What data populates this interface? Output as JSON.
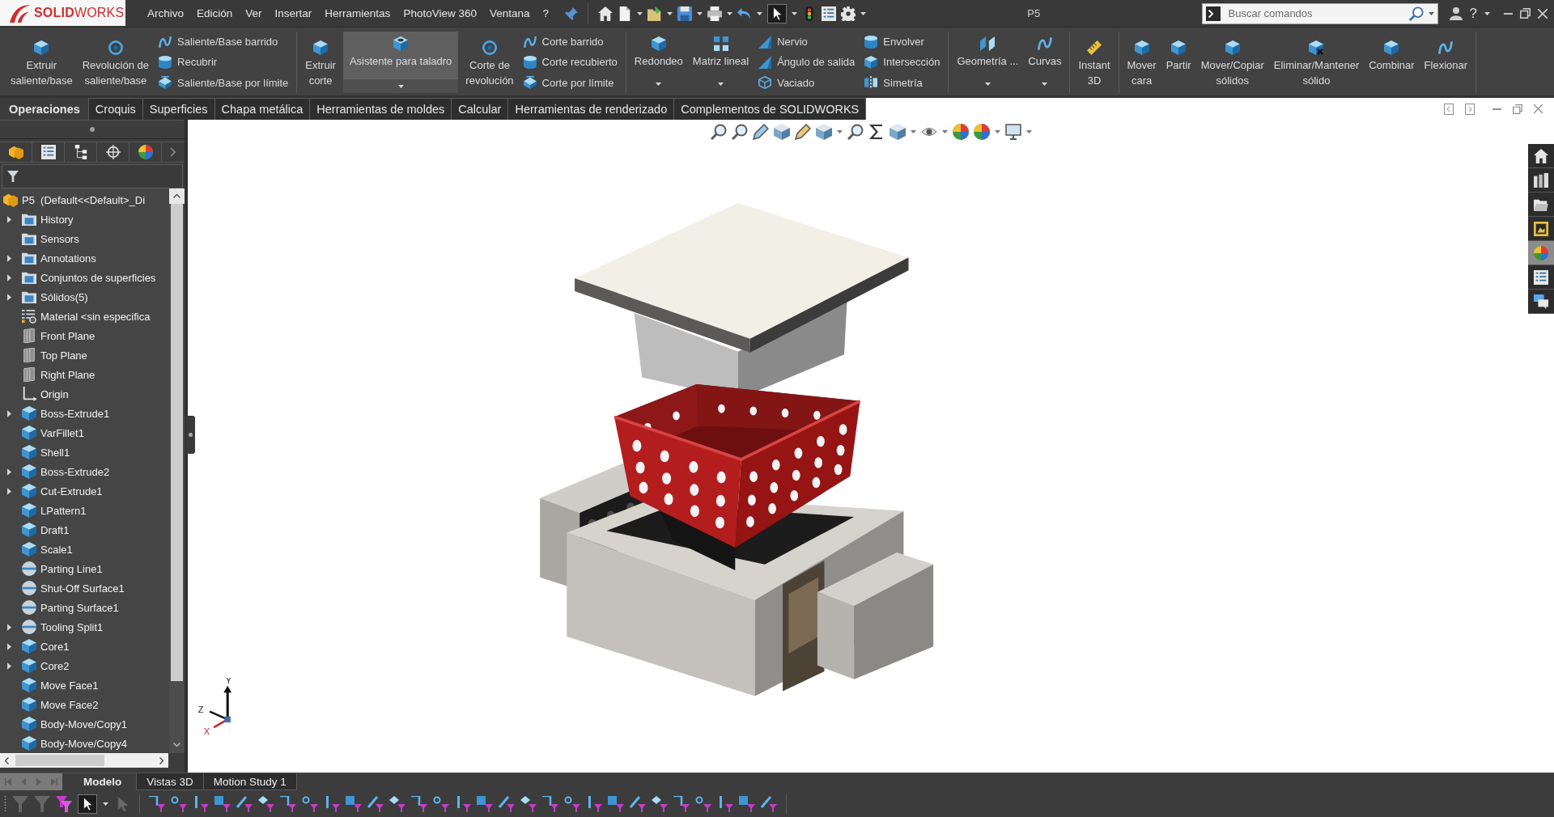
{
  "app_bar": {
    "logo": "**SOLID**WORKS",
    "menu": [
      "Archivo",
      "Edición",
      "Ver",
      "Insertar",
      "Herramientas",
      "PhotoView 360",
      "Ventana",
      "?"
    ],
    "quick_access": [
      {
        "pressed": false
      },
      {
        "pressed": false
      },
      {
        "pressed": false
      },
      {
        "pressed": false
      },
      {
        "pressed": false
      },
      {
        "pressed": false
      },
      {
        "pressed": true
      },
      {
        "pressed": false
      },
      {
        "pressed": false
      },
      {
        "pressed": false
      }
    ],
    "document_title": "P5",
    "search": {
      "placeholder": "Buscar comandos"
    },
    "help": "?"
  },
  "command_manager": {
    "groups": [
      {
        "items": [
          {
            "kind": "button",
            "label": "Extruir\nsaliente/base",
            "hovered": false
          },
          {
            "kind": "button",
            "label": "Revolución de\nsaliente/base",
            "hovered": false
          },
          {
            "kind": "stack",
            "commands": [
              "Saliente/Base barrido",
              "Recubrir",
              "Saliente/Base por límite"
            ]
          }
        ]
      },
      {
        "items": [
          {
            "kind": "button",
            "label": "Extruir\ncorte",
            "hovered": false
          },
          {
            "kind": "split",
            "label": "Asistente para taladro",
            "hovered": true
          },
          {
            "kind": "button",
            "label": "Corte de\nrevolución",
            "hovered": false
          },
          {
            "kind": "stack",
            "commands": [
              "Corte barrido",
              "Corte recubierto",
              "Corte por límite"
            ]
          }
        ]
      },
      {
        "items": [
          {
            "kind": "menu",
            "label": "Redondeo",
            "hovered": false
          },
          {
            "kind": "menu",
            "label": "Matriz lineal",
            "hovered": false
          },
          {
            "kind": "stack",
            "commands": [
              "Nervio",
              "Ángulo de salida",
              "Vaciado"
            ]
          },
          {
            "kind": "stack",
            "commands": [
              "Envolver",
              "Intersección",
              "Simetría"
            ]
          }
        ]
      },
      {
        "items": [
          {
            "kind": "menu",
            "label": "Geometría ...",
            "hovered": false
          },
          {
            "kind": "menu",
            "label": "Curvas",
            "hovered": false
          }
        ]
      },
      {
        "items": [
          {
            "kind": "button",
            "label": "Instant\n3D",
            "hovered": false
          }
        ]
      },
      {
        "items": [
          {
            "kind": "button",
            "label": "Mover\ncara",
            "hovered": false
          },
          {
            "kind": "button",
            "label": "Partir",
            "hovered": false
          },
          {
            "kind": "button",
            "label": "Mover/Copiar\nsólidos",
            "hovered": false
          },
          {
            "kind": "button",
            "label": "Eliminar/Mantener\nsólido",
            "hovered": false
          },
          {
            "kind": "button",
            "label": "Combinar",
            "hovered": false
          },
          {
            "kind": "button",
            "label": "Flexionar",
            "hovered": false
          }
        ]
      }
    ]
  },
  "tabs": [
    {
      "label": "Operaciones",
      "selected": true
    },
    {
      "label": "Croquis",
      "selected": false
    },
    {
      "label": "Superficies",
      "selected": false
    },
    {
      "label": "Chapa metálica",
      "selected": false
    },
    {
      "label": "Herramientas de moldes",
      "selected": false
    },
    {
      "label": "Calcular",
      "selected": false
    },
    {
      "label": "Herramientas de renderizado",
      "selected": false
    },
    {
      "label": "Complementos de SOLIDWORKS",
      "selected": false
    }
  ],
  "feature_tree": {
    "root": {
      "label": "P5  (Default<<Default>_Di",
      "kind": "part",
      "children": [
        {
          "label": "History",
          "kind": "folder",
          "collapsed": true
        },
        {
          "label": "Sensors",
          "kind": "folder",
          "collapsed": false
        },
        {
          "label": "Annotations",
          "kind": "folder",
          "collapsed": true
        },
        {
          "label": "Conjuntos de superficies",
          "kind": "folder",
          "collapsed": true
        },
        {
          "label": "Sólidos(5)",
          "kind": "folder",
          "collapsed": true
        },
        {
          "label": "Material <sin especifica",
          "kind": "material",
          "collapsed": false
        },
        {
          "label": "Front Plane",
          "kind": "plane",
          "collapsed": false
        },
        {
          "label": "Top Plane",
          "kind": "plane",
          "collapsed": false
        },
        {
          "label": "Right Plane",
          "kind": "plane",
          "collapsed": false
        },
        {
          "label": "Origin",
          "kind": "origin",
          "collapsed": false
        },
        {
          "label": "Boss-Extrude1",
          "kind": "feature",
          "collapsed": true
        },
        {
          "label": "VarFillet1",
          "kind": "feature",
          "collapsed": false
        },
        {
          "label": "Shell1",
          "kind": "feature",
          "collapsed": false
        },
        {
          "label": "Boss-Extrude2",
          "kind": "feature",
          "collapsed": true
        },
        {
          "label": "Cut-Extrude1",
          "kind": "feature",
          "collapsed": true
        },
        {
          "label": "LPattern1",
          "kind": "feature",
          "collapsed": false
        },
        {
          "label": "Draft1",
          "kind": "feature",
          "collapsed": false
        },
        {
          "label": "Scale1",
          "kind": "feature",
          "collapsed": false
        },
        {
          "label": "Parting Line1",
          "kind": "mold",
          "collapsed": false
        },
        {
          "label": "Shut-Off Surface1",
          "kind": "mold",
          "collapsed": false
        },
        {
          "label": "Parting Surface1",
          "kind": "mold",
          "collapsed": false
        },
        {
          "label": "Tooling Split1",
          "kind": "mold",
          "collapsed": true
        },
        {
          "label": "Core1",
          "kind": "feature",
          "collapsed": true
        },
        {
          "label": "Core2",
          "kind": "feature",
          "collapsed": true
        },
        {
          "label": "Move Face1",
          "kind": "feature",
          "collapsed": false
        },
        {
          "label": "Move Face2",
          "kind": "feature",
          "collapsed": false
        },
        {
          "label": "Body-Move/Copy1",
          "kind": "feature",
          "collapsed": false
        },
        {
          "label": "Body-Move/Copy4",
          "kind": "feature",
          "collapsed": false
        }
      ]
    }
  },
  "task_pane": {
    "tabs": [
      {
        "selected": false
      },
      {
        "selected": false
      },
      {
        "selected": false
      },
      {
        "selected": false
      },
      {
        "selected": true
      },
      {
        "selected": false
      },
      {
        "selected": false
      }
    ]
  },
  "triad": {
    "labels": [
      "Y",
      "Z",
      "X"
    ]
  },
  "bottom_tabs": [
    {
      "label": "Modelo",
      "selected": true
    },
    {
      "label": "Vistas 3D",
      "selected": false
    },
    {
      "label": "Motion Study 1",
      "selected": false
    }
  ],
  "selection_toolbar": {
    "tools": [
      {
        "disabled": true,
        "pressed": false
      },
      {
        "disabled": true,
        "pressed": false
      },
      {
        "disabled": false,
        "pressed": false
      },
      {
        "disabled": false,
        "pressed": true
      },
      {
        "disabled": true,
        "pressed": false
      },
      {
        "disabled": false,
        "pressed": false
      },
      {
        "disabled": false,
        "pressed": false
      },
      {
        "disabled": false,
        "pressed": false
      },
      {
        "disabled": false,
        "pressed": false
      },
      {
        "disabled": false,
        "pressed": false
      },
      {
        "disabled": false,
        "pressed": false
      },
      {
        "disabled": false,
        "pressed": false
      },
      {
        "disabled": false,
        "pressed": false
      },
      {
        "disabled": false,
        "pressed": false
      },
      {
        "disabled": false,
        "pressed": false
      },
      {
        "disabled": false,
        "pressed": false
      },
      {
        "disabled": false,
        "pressed": false
      },
      {
        "disabled": false,
        "pressed": false
      },
      {
        "disabled": false,
        "pressed": false
      },
      {
        "disabled": false,
        "pressed": false
      },
      {
        "disabled": false,
        "pressed": false
      },
      {
        "disabled": false,
        "pressed": false
      },
      {
        "disabled": false,
        "pressed": false
      },
      {
        "disabled": false,
        "pressed": false
      },
      {
        "disabled": false,
        "pressed": false
      },
      {
        "disabled": false,
        "pressed": false
      },
      {
        "disabled": false,
        "pressed": false
      },
      {
        "disabled": false,
        "pressed": false
      },
      {
        "disabled": false,
        "pressed": false
      },
      {
        "disabled": false,
        "pressed": false
      },
      {
        "disabled": false,
        "pressed": false
      },
      {
        "disabled": false,
        "pressed": false
      },
      {
        "disabled": false,
        "pressed": false
      },
      {
        "disabled": false,
        "pressed": false
      }
    ]
  }
}
